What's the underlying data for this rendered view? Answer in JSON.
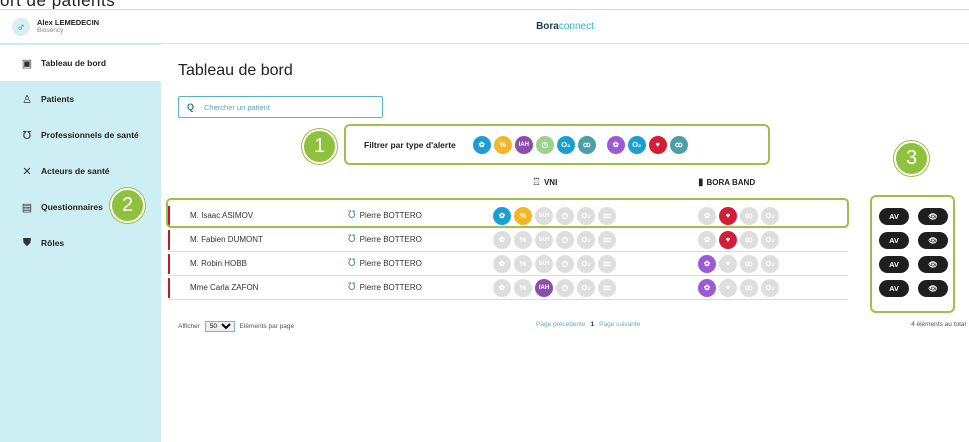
{
  "top_fragment": "ort de patients",
  "user": {
    "name": "Alex LEMEDECIN",
    "org": "Biosency"
  },
  "brand": {
    "part1": "Bora",
    "part2": "connect"
  },
  "sidebar": {
    "items": [
      {
        "label": "Tableau de bord",
        "icon": "calendar-icon"
      },
      {
        "label": "Patients",
        "icon": "person-icon"
      },
      {
        "label": "Professionnels de santé",
        "icon": "stethoscope-icon"
      },
      {
        "label": "Acteurs de santé",
        "icon": "tools-icon"
      },
      {
        "label": "Questionnaires",
        "icon": "form-icon"
      },
      {
        "label": "Rôles",
        "icon": "shield-icon"
      }
    ]
  },
  "page_title": "Tableau de bord",
  "search": {
    "placeholder": "Chercher un patient"
  },
  "filter": {
    "label": "Filtrer par type d'alerte",
    "vni_icons": [
      {
        "name": "gear-alert-icon",
        "text": "✿",
        "color": "#1b9fd3"
      },
      {
        "name": "leak-alert-icon",
        "text": "%",
        "color": "#f2b62b"
      },
      {
        "name": "iah-alert-icon",
        "text": "IAH",
        "color": "#8a4fa8"
      },
      {
        "name": "clock-alert-icon",
        "text": "◷",
        "color": "#9ad18b"
      },
      {
        "name": "oxygen-alert-icon",
        "text": "O₂",
        "color": "#1b9fd3"
      },
      {
        "name": "lungs-alert-icon",
        "text": "ꝏ",
        "color": "#4e9ea8"
      }
    ],
    "band_icons": [
      {
        "name": "gear-alert-icon",
        "text": "✿",
        "color": "#9b5bd6"
      },
      {
        "name": "oxygen-alert-icon",
        "text": "O₂",
        "color": "#1b9fd3"
      },
      {
        "name": "heart-alert-icon",
        "text": "♥",
        "color": "#d11f3a"
      },
      {
        "name": "lungs-alert-icon",
        "text": "ꝏ",
        "color": "#4e9ea8"
      }
    ]
  },
  "annotations": [
    "1",
    "2",
    "3"
  ],
  "columns": {
    "vni": "VNI",
    "band": "BORA BAND"
  },
  "patients": [
    {
      "name": "M. Isaac ASIMOV",
      "doctor": "Pierre BOTTERO",
      "vni_active": [
        0,
        1
      ],
      "band_active": [
        1
      ]
    },
    {
      "name": "M. Fabien DUMONT",
      "doctor": "Pierre BOTTERO",
      "vni_active": [],
      "band_active": [
        1
      ]
    },
    {
      "name": "M. Robin HOBB",
      "doctor": "Pierre BOTTERO",
      "vni_active": [],
      "band_active": [
        0
      ]
    },
    {
      "name": "Mme Carla ZAFON",
      "doctor": "Pierre BOTTERO",
      "vni_active": [
        2
      ],
      "band_active": [
        0
      ]
    }
  ],
  "actions": {
    "av": "AV",
    "eye": "👁"
  },
  "footer": {
    "afficher": "Afficher",
    "per_page_value": "50",
    "per_page_suffix": "Eléments par page",
    "prev": "Page précédente",
    "page": "1",
    "next": "Page suivante",
    "total": "4 éléments au total"
  }
}
